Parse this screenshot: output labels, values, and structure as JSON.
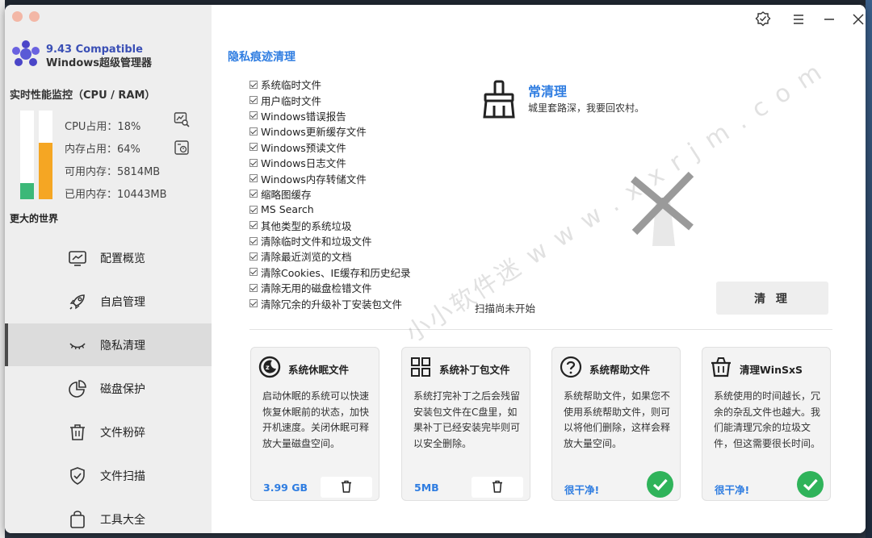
{
  "app": {
    "version_line": "9.43 Compatible",
    "name_line": "Windows超级管理器"
  },
  "monitor": {
    "title": "实时性能监控（CPU / RAM）",
    "cpu_label": "CPU占用：18%",
    "mem_label": "内存占用：64%",
    "avail_label": "可用内存：5814MB",
    "used_label": "已用内存：10443MB",
    "cpu_percent": 18,
    "mem_percent": 64
  },
  "sidebar": {
    "section": "更大的世界",
    "items": [
      {
        "label": "配置概览",
        "icon": "monitor-chart-icon"
      },
      {
        "label": "自启管理",
        "icon": "rocket-icon"
      },
      {
        "label": "隐私清理",
        "icon": "closed-eye-icon",
        "active": true
      },
      {
        "label": "磁盘保护",
        "icon": "pie-chart-icon"
      },
      {
        "label": "文件粉碎",
        "icon": "trash-icon"
      },
      {
        "label": "文件扫描",
        "icon": "shield-check-icon"
      },
      {
        "label": "工具大全",
        "icon": "bag-icon"
      }
    ]
  },
  "main": {
    "title": "隐私痕迹清理",
    "checklist": [
      "系统临时文件",
      "用户临时文件",
      "Windows错误报告",
      "Windows更新缓存文件",
      "Windows预读文件",
      "Windows日志文件",
      "Windows内存转储文件",
      "缩略图缓存",
      "MS Search",
      "其他类型的系统垃圾",
      "清除临时文件和垃圾文件",
      "清除最近浏览的文档",
      "清除Cookies、IE缓存和历史纪录",
      "清除无用的磁盘检错文件",
      "清除冗余的升级补丁安装包文件"
    ],
    "clean_title": "常清理",
    "clean_subtitle": "城里套路深，我要回农村。",
    "scan_status": "扫描尚未开始",
    "clean_button": "清 理"
  },
  "cards": [
    {
      "title": "系统休眠文件",
      "icon": "sleep-icon",
      "desc": "启动休眠的系统可以快速恢复休眠前的状态，加快开机速度。关闭休眠可释放大量磁盘空间。",
      "size": "3.99 GB",
      "state": "delete"
    },
    {
      "title": "系统补丁包文件",
      "icon": "grid-icon",
      "desc": "系统打完补丁之后会残留安装包文件在C盘里，如果补丁已经安装完毕则可以安全删除。",
      "size": "5MB",
      "state": "delete"
    },
    {
      "title": "系统帮助文件",
      "icon": "help-icon",
      "desc": "系统帮助文件，如果您不使用系统帮助文件，则可以将他们删除，这样会释放大量空间。",
      "size": "很干净!",
      "state": "ok"
    },
    {
      "title": "清理WinSxS",
      "icon": "basket-icon",
      "desc": "系统使用的时间越长，冗余的杂乱文件也越大。我们能清理冗余的垃圾文件，但这需要很长时间。",
      "size": "很干净!",
      "state": "ok"
    }
  ],
  "watermark": "小小软件迷  w w w . x x r j m . c o m",
  "colors": {
    "accent": "#2f7de1",
    "cpu": "#3cb878",
    "mem": "#f5a623",
    "ok": "#2fb35a"
  }
}
